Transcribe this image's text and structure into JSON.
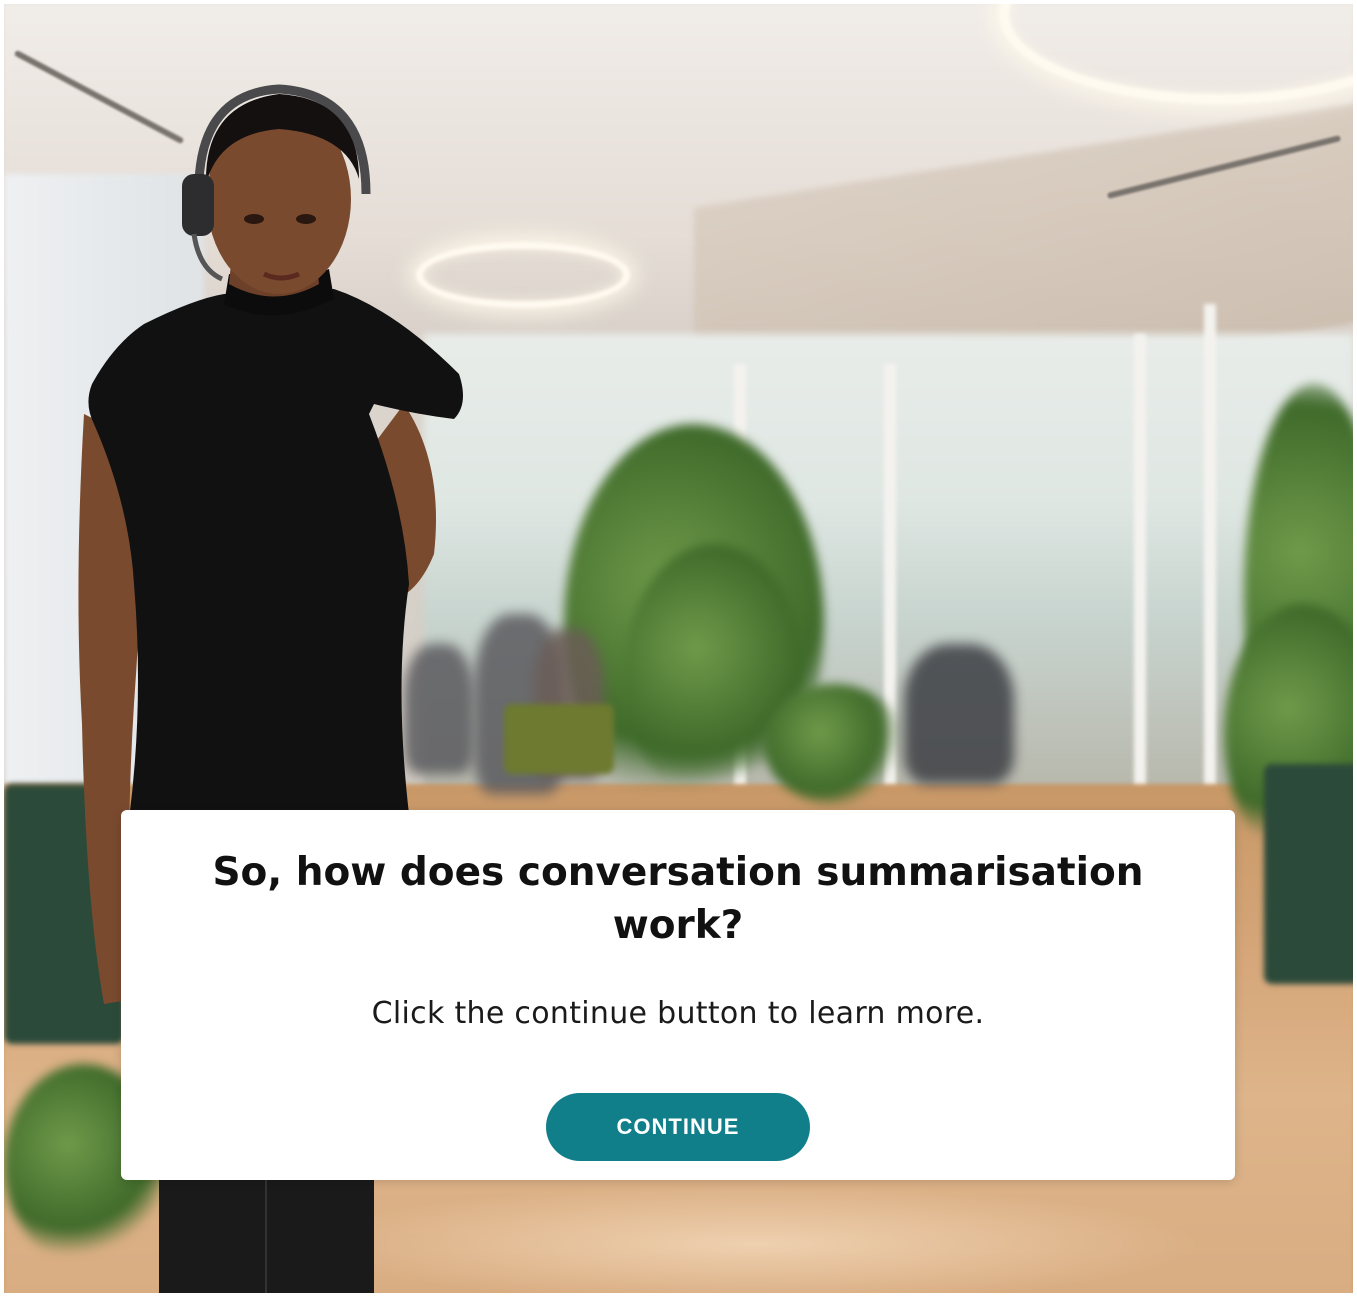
{
  "scene": {
    "background": "blurred-office-photo",
    "character": "woman-with-headset-thinking"
  },
  "dialog": {
    "title": "So, how does conversation summarisation work?",
    "body": "Click the continue button to learn more.",
    "continue_label": "CONTINUE"
  },
  "colors": {
    "button": "#117f8a",
    "button_text": "#ffffff",
    "dialog_bg": "#ffffff",
    "title_text": "#111111"
  }
}
